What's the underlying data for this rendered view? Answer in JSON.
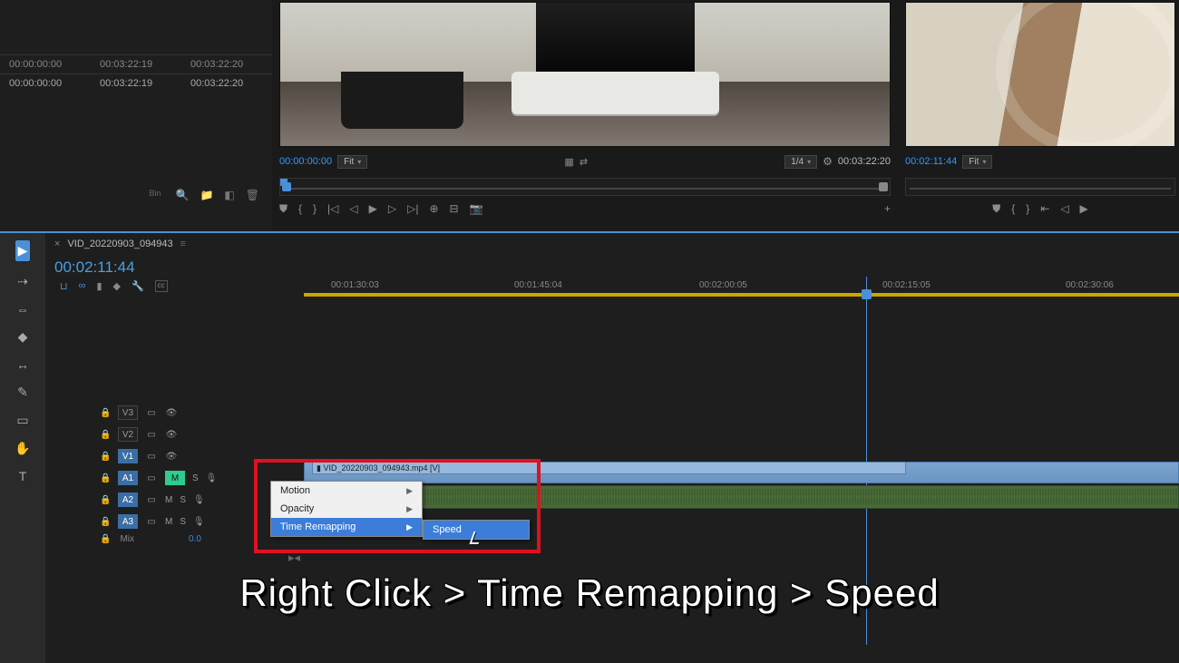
{
  "top_left": {
    "col1_a": "00:00:00:00",
    "col2_a": "00:03:22:19",
    "col3_a": "00:03:22:20",
    "col1_b": "00:00:00:00",
    "col2_b": "00:03:22:19",
    "col3_b": "00:03:22:20",
    "bin_label": "Bin"
  },
  "source": {
    "timecode": "00:00:00:00",
    "fit": "Fit",
    "quality": "1/4",
    "duration": "00:03:22:20"
  },
  "program": {
    "timecode": "00:02:11:44",
    "fit": "Fit"
  },
  "sequence": {
    "tab_name": "VID_20220903_094943",
    "playhead_tc": "00:02:11:44",
    "ruler": [
      "00:01:30:03",
      "00:01:45:04",
      "00:02:00:05",
      "00:02:15:05",
      "00:02:30:06"
    ],
    "clip_name": "VID_20220903_094943.mp4 [V]"
  },
  "tracks": {
    "v3": "V3",
    "v2": "V2",
    "v1": "V1",
    "a1": "A1",
    "a2": "A2",
    "a3": "A3",
    "m": "M",
    "s": "S",
    "mix": "Mix",
    "mix_val": "0.0",
    "lock": "🔒"
  },
  "tools": {
    "select": "▶",
    "track_sel": "⇢",
    "ripple": "⇔",
    "razor": "◆",
    "slip": "↔",
    "pen": "✎",
    "rect": "▭",
    "hand": "✋",
    "text": "T"
  },
  "menu": {
    "motion": "Motion",
    "opacity": "Opacity",
    "time_remap": "Time Remapping",
    "speed": "Speed"
  },
  "caption": "Right Click > Time Remapping > Speed",
  "icons": {
    "search": "🔍",
    "folder": "📁",
    "new": "◧",
    "trash": "🗑",
    "mark_in": "◖",
    "mark_out": "◗",
    "go_in": "|◁",
    "step_b": "◁",
    "play": "▶",
    "step_f": "▷",
    "go_out": "▷|",
    "insert": "⊕",
    "over": "⊟",
    "cam": "📷",
    "plus": "+",
    "shield": "⛊",
    "lbr": "{",
    "rbr": "}",
    "snap": "⇤",
    "eye": "👁",
    "settings": "⚙",
    "menu": "≡",
    "magnet": "⊔",
    "link": "∞",
    "marker": "◆",
    "wrench": "🔧",
    "cc": "cc"
  }
}
